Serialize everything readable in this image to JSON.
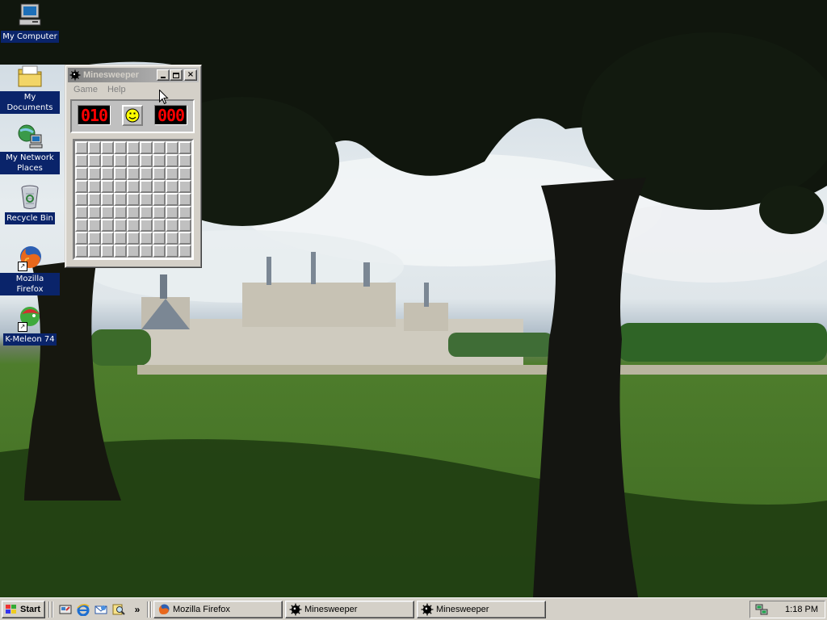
{
  "desktop": {
    "icons": [
      {
        "label": "My Computer",
        "icon": "my-computer-icon"
      },
      {
        "label": "My Documents",
        "icon": "my-documents-icon"
      },
      {
        "label": "My Network Places",
        "icon": "network-places-icon"
      },
      {
        "label": "Recycle Bin",
        "icon": "recycle-bin-icon"
      },
      {
        "label": "Mozilla Firefox",
        "icon": "firefox-icon"
      },
      {
        "label": "K-Meleon 74",
        "icon": "k-meleon-icon"
      }
    ]
  },
  "minesweeper": {
    "title": "Minesweeper",
    "menu": {
      "game": "Game",
      "help": "Help"
    },
    "mine_counter": "010",
    "timer": "000",
    "rows": 9,
    "cols": 9,
    "state": "inactive-window"
  },
  "taskbar": {
    "start_label": "Start",
    "quick_launch": [
      "show-desktop-icon",
      "internet-explorer-icon",
      "outlook-express-icon",
      "search-icon"
    ],
    "overflow": "»",
    "tasks": [
      {
        "label": "Mozilla Firefox",
        "icon": "firefox-icon"
      },
      {
        "label": "Minesweeper",
        "icon": "mine-icon"
      },
      {
        "label": "Minesweeper",
        "icon": "mine-icon"
      }
    ],
    "clock": "1:18 PM"
  },
  "colors": {
    "selection": "#0a246a",
    "face": "#d4d0c8",
    "inactive_title": "#808080",
    "lcd_red": "#ff0000"
  }
}
